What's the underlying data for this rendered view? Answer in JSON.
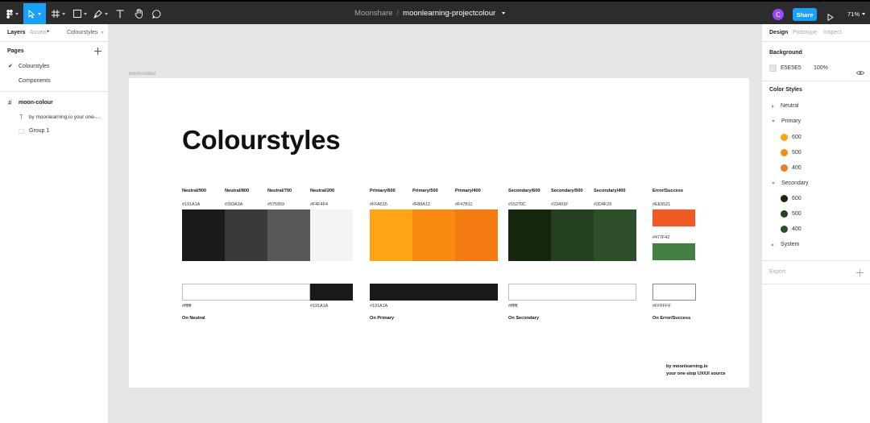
{
  "toolbar": {
    "project": "Moonshare",
    "separator": "/",
    "file_name": "moonlearning-projectcolour",
    "avatar_initial": "C",
    "share_label": "Share",
    "zoom": "71%"
  },
  "left_panel": {
    "tab_layers": "Layers",
    "tab_assets": "Assets",
    "assets_marker": "●",
    "page_select": "Colourstyles",
    "pages_title": "Pages",
    "pages": [
      {
        "label": "Colourstyles",
        "checkmark": "✔"
      },
      {
        "label": "Components",
        "checkmark": ""
      }
    ],
    "layers": [
      {
        "label": "moon-colour",
        "icon": "#"
      },
      {
        "label": "by moonlearning.io your one-...",
        "icon": "T"
      },
      {
        "label": "Group 1",
        "icon": "⬚"
      }
    ]
  },
  "canvas": {
    "frame_label": "moon-colour",
    "title": "Colourstyles",
    "swatches": [
      {
        "name": "Neutral/900",
        "hex": "#191A1A",
        "color": "#191A1A"
      },
      {
        "name": "Neutral/800",
        "hex": "#393A3A",
        "color": "#393A3A"
      },
      {
        "name": "Neutral/700",
        "hex": "#575959",
        "color": "#575959"
      },
      {
        "name": "Neutral/200",
        "hex": "#F4F4F4",
        "color": "#F4F4F4"
      },
      {
        "name": "Primary/600",
        "hex": "#FFA515",
        "color": "#FFA515"
      },
      {
        "name": "Primary/500",
        "hex": "#F88A12",
        "color": "#F88A12"
      },
      {
        "name": "Primary/400",
        "hex": "#F47B11",
        "color": "#F47B11"
      },
      {
        "name": "Secondary/600",
        "hex": "#15270C",
        "color": "#15270C"
      },
      {
        "name": "Secondary/500",
        "hex": "#23401F",
        "color": "#23401F"
      },
      {
        "name": "Secondary/400",
        "hex": "#2D4F29",
        "color": "#2D4F29"
      }
    ],
    "error_success": {
      "name": "Error/Success",
      "error_hex": "#EE5521",
      "error_color": "#F05A22",
      "success_hex": "#477F42",
      "success_color": "#447F42"
    },
    "on_colors": [
      {
        "hex": "#ffffff",
        "color": "#FFFFFF",
        "label": "On Neutral"
      },
      {
        "hex": "#191A1A",
        "color": "#191A1A",
        "label": ""
      },
      {
        "hex": "#191A1A",
        "color": "#191A1A",
        "label": "On Primary"
      },
      {
        "hex": "#ffffff",
        "color": "#FFFFFF",
        "label": "On Secondary"
      },
      {
        "hex": "#FFFFFF",
        "color": "#FFFFFF",
        "label": "On Error/Success"
      }
    ],
    "credit_line1": "by moonlearning.io",
    "credit_line2": "your one-stop UX/UI source"
  },
  "right_panel": {
    "tab_design": "Design",
    "tab_prototype": "Prototype",
    "tab_inspect": "Inspect",
    "background_title": "Background",
    "background_hex": "E5E5E5",
    "background_opacity": "100%",
    "color_styles_title": "Color Styles",
    "groups": [
      {
        "label": "Neutral",
        "expanded": false,
        "items": []
      },
      {
        "label": "Primary",
        "expanded": true,
        "items": [
          {
            "label": "600",
            "color": "#FFA515"
          },
          {
            "label": "500",
            "color": "#F88A12"
          },
          {
            "label": "400",
            "color": "#F47B11"
          }
        ]
      },
      {
        "label": "Secondary",
        "expanded": true,
        "items": [
          {
            "label": "600",
            "color": "#15270C"
          },
          {
            "label": "500",
            "color": "#23401F"
          },
          {
            "label": "400",
            "color": "#2D4F29"
          }
        ]
      },
      {
        "label": "System",
        "expanded": false,
        "items": []
      }
    ],
    "export_title": "Export"
  }
}
